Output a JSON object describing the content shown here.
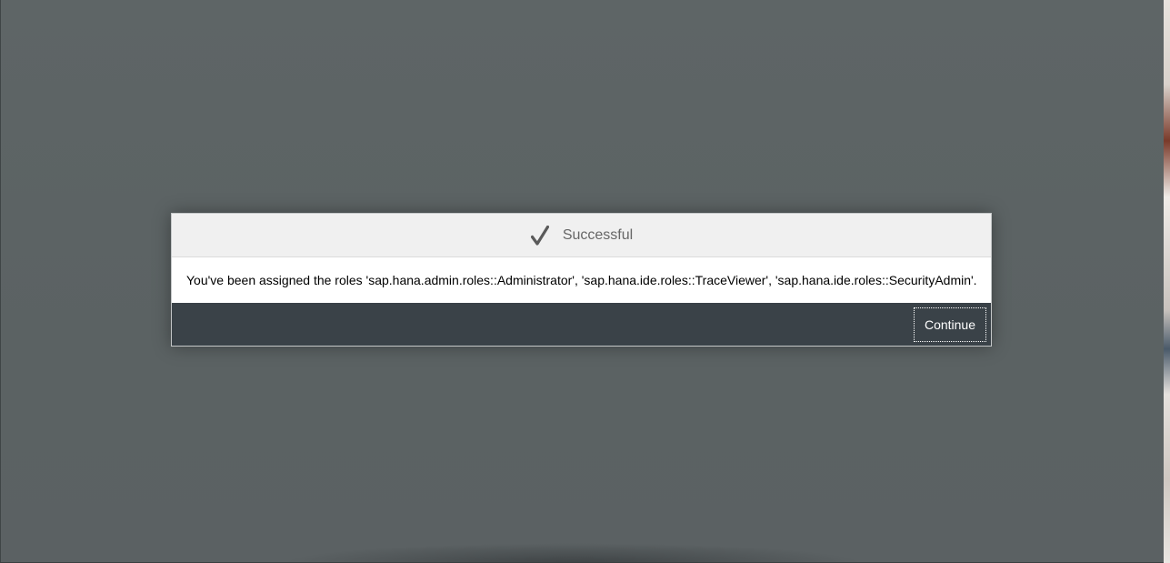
{
  "dialog": {
    "title": "Successful",
    "icon": "checkmark-icon",
    "message": "You've been assigned the roles 'sap.hana.admin.roles::Administrator', 'sap.hana.ide.roles::TraceViewer', 'sap.hana.ide.roles::SecurityAdmin'.",
    "continue_label": "Continue"
  },
  "colors": {
    "overlay": "#5c6263",
    "header_bg": "#f0f0f0",
    "footer_bg": "#3a4248",
    "title_text": "#666666",
    "icon": "#5a5a5a"
  }
}
